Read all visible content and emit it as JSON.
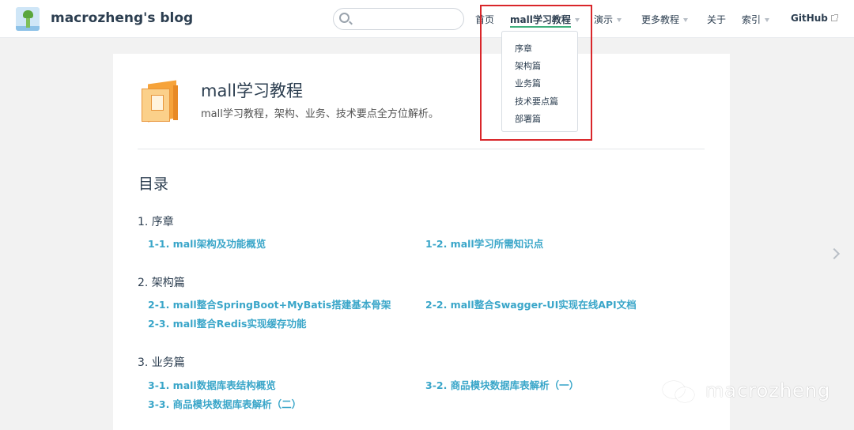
{
  "header": {
    "site_name": "macrozheng's blog",
    "search_placeholder": ""
  },
  "nav": {
    "home": "首页",
    "mall_tutorial": "mall学习教程",
    "demo": "演示",
    "more_tutorials": "更多教程",
    "about": "关于",
    "index": "索引",
    "github": "GitHub"
  },
  "dropdown": {
    "items": [
      "序章",
      "架构篇",
      "业务篇",
      "技术要点篇",
      "部署篇"
    ]
  },
  "hero": {
    "title": "mall学习教程",
    "description": "mall学习教程，架构、业务、技术要点全方位解析。"
  },
  "toc": {
    "title": "目录",
    "sections": [
      {
        "title": "1. 序章",
        "links": [
          "1-1. mall架构及功能概览",
          "1-2. mall学习所需知识点"
        ]
      },
      {
        "title": "2. 架构篇",
        "links": [
          "2-1. mall整合SpringBoot+MyBatis搭建基本骨架",
          "2-2. mall整合Swagger-UI实现在线API文档",
          "2-3. mall整合Redis实现缓存功能"
        ]
      },
      {
        "title": "3. 业务篇",
        "links": [
          "3-1. mall数据库表结构概览",
          "3-2. 商品模块数据库表解析（一）",
          "3-3. 商品模块数据库表解析（二）"
        ]
      }
    ]
  },
  "watermark": {
    "text": "macrozheng"
  },
  "icons": {
    "logo": "avatar-logo-icon",
    "search": "search-icon",
    "caret": "chevron-down-icon",
    "external": "external-link-icon",
    "hero": "book-icon",
    "next": "chevron-right-icon",
    "wechat": "wechat-icon"
  },
  "colors": {
    "accent": "#3eaf7c",
    "link": "#3aa6c9",
    "highlight": "#d9262a"
  }
}
